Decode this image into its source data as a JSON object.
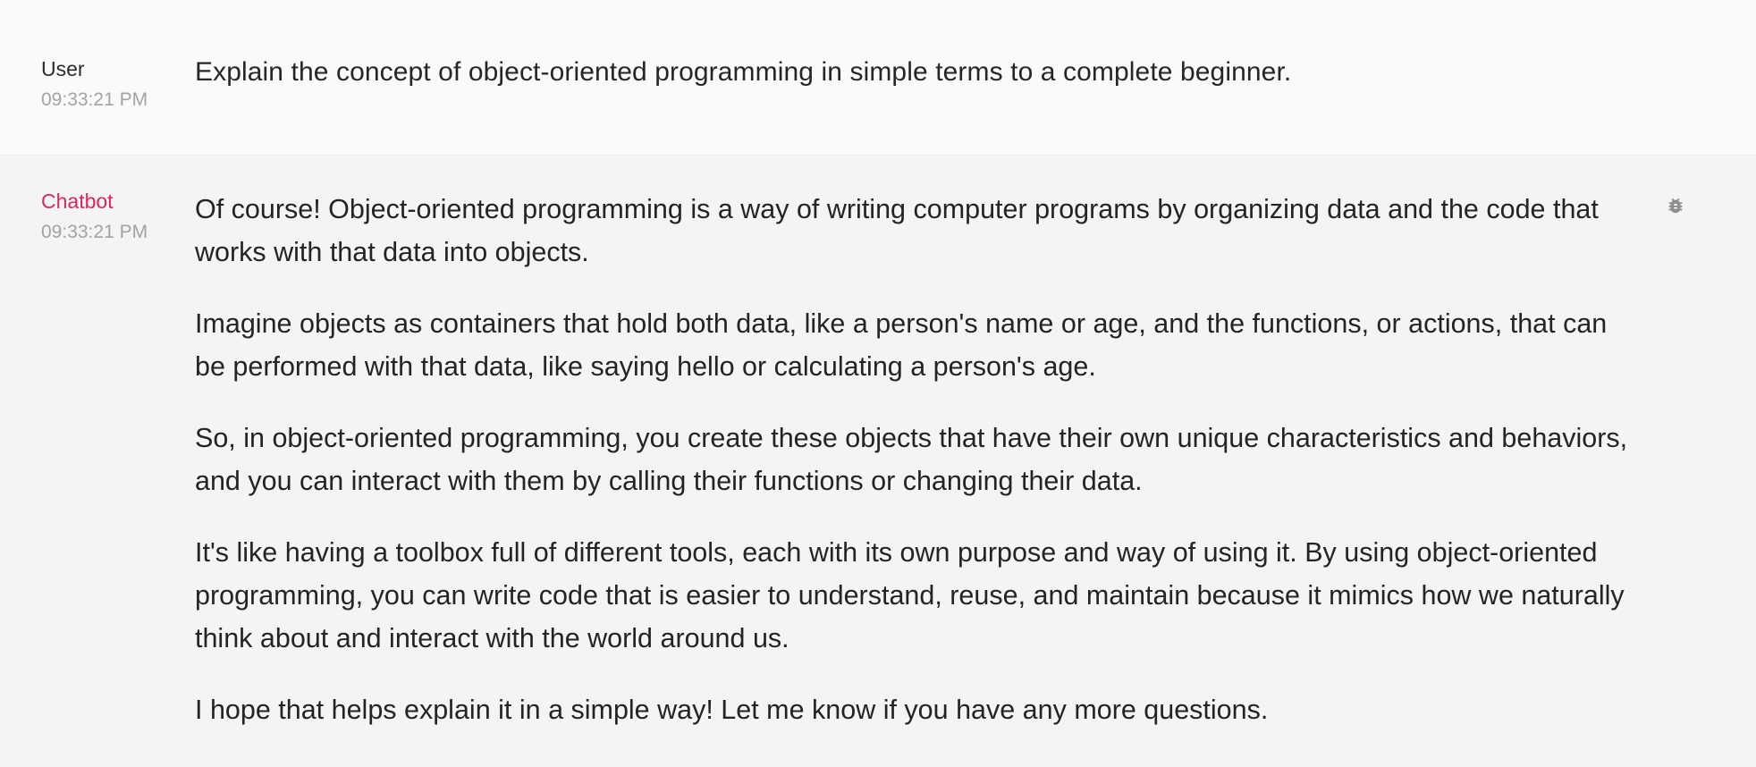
{
  "messages": {
    "user": {
      "author": "User",
      "time": "09:33:21 PM",
      "text": "Explain the concept of object-oriented programming in simple terms to a complete beginner."
    },
    "bot": {
      "author": "Chatbot",
      "time": "09:33:21 PM",
      "paragraphs": [
        "Of course! Object-oriented programming is a way of writing computer programs by organizing data and the code that works with that data into objects.",
        "Imagine objects as containers that hold both data, like a person's name or age, and the functions, or actions, that can be performed with that data, like saying hello or calculating a person's age.",
        "So, in object-oriented programming, you create these objects that have their own unique characteristics and behaviors, and you can interact with them by calling their functions or changing their data.",
        "It's like having a toolbox full of different tools, each with its own purpose and way of using it. By using object-oriented programming, you can write code that is easier to understand, reuse, and maintain because it mimics how we naturally think about and interact with the world around us.",
        "I hope that helps explain it in a simple way! Let me know if you have any more questions."
      ],
      "action_icon": "bug-icon"
    }
  },
  "colors": {
    "bot_author": "#d8295c",
    "timestamp": "#a3a3a3",
    "user_row_bg": "#fafafa",
    "bot_row_bg": "#f4f4f4"
  }
}
